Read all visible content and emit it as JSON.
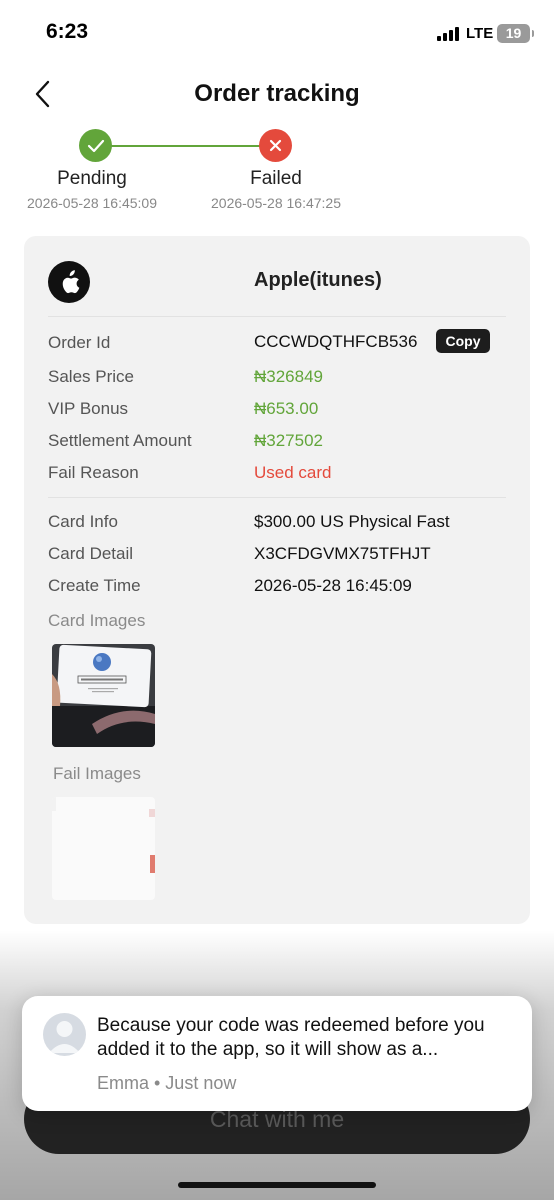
{
  "status_bar": {
    "time": "6:23",
    "network": "LTE",
    "battery": "19"
  },
  "header": {
    "title": "Order tracking",
    "back_icon": "chevron-left-icon"
  },
  "progress": {
    "steps": [
      {
        "label": "Pending",
        "time": "2026-05-28 16:45:09",
        "status": "success",
        "icon": "check-icon",
        "color": "#62a53a"
      },
      {
        "label": "Failed",
        "time": "2026-05-28 16:47:25",
        "status": "failed",
        "icon": "close-icon",
        "color": "#e44a3c"
      }
    ]
  },
  "order": {
    "brand": "Apple(itunes)",
    "brand_icon": "apple-icon",
    "copy_label": "Copy",
    "fields": [
      {
        "label": "Order Id",
        "value": "CCCWDQTHFCB536"
      },
      {
        "label": "Sales Price",
        "value": "₦326849"
      },
      {
        "label": "VIP Bonus",
        "value": "₦653.00"
      },
      {
        "label": "Settlement Amount",
        "value": "₦327502"
      },
      {
        "label": "Fail Reason",
        "value": "Used card"
      }
    ],
    "details": [
      {
        "label": "Card Info",
        "value": "$300.00 US Physical Fast"
      },
      {
        "label": "Card Detail",
        "value": "X3CFDGVMX75TFHJT"
      },
      {
        "label": "Create Time",
        "value": "2026-05-28 16:45:09"
      }
    ],
    "card_images_label": "Card Images",
    "fail_images_label": "Fail Images",
    "card_image_code": "X3CFDGVMX75TFHJT"
  },
  "chat": {
    "label": "Chat with me"
  },
  "notification": {
    "message": "Because your code was redeemed before you added it to the app, so it will show as a...",
    "sender": "Emma",
    "time": "Just now",
    "meta": "Emma • Just now",
    "avatar_icon": "user-avatar-icon"
  },
  "colors": {
    "success": "#62a53a",
    "failure": "#e44a3c",
    "card_background": "#f2f2f2"
  }
}
